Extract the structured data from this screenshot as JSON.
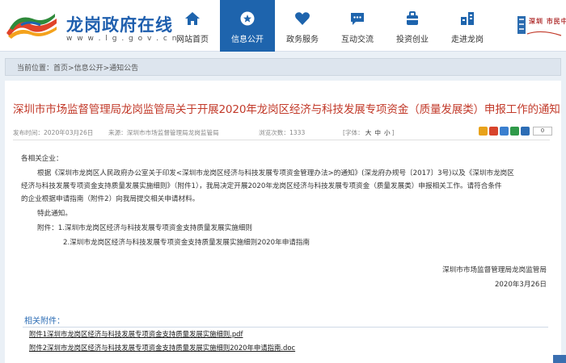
{
  "site": {
    "title": "龙岗政府在线",
    "url": "w w w . l g . g o v . c n",
    "brand_badge": "深圳 市民中心"
  },
  "nav": {
    "items": [
      {
        "label": "网站首页",
        "icon": "home-icon",
        "active": false
      },
      {
        "label": "信息公开",
        "icon": "info-icon",
        "active": true
      },
      {
        "label": "政务服务",
        "icon": "heart-icon",
        "active": false
      },
      {
        "label": "互动交流",
        "icon": "chat-icon",
        "active": false
      },
      {
        "label": "投资创业",
        "icon": "invest-icon",
        "active": false
      },
      {
        "label": "走进龙岗",
        "icon": "building-icon",
        "active": false
      }
    ]
  },
  "breadcrumb": {
    "prefix": "当前位置：",
    "items": [
      "首页",
      "信息公开",
      "通知公告"
    ],
    "separator": ">"
  },
  "article": {
    "title": "深圳市市场监督管理局龙岗监管局关于开展2020年龙岗区经济与科技发展专项资金（质量发展类）申报工作的通知",
    "meta": {
      "date_label": "发布时间：",
      "date": "2020年03月26日",
      "source_label": "来源：",
      "source": "深圳市市场监督管理局龙岗监管局",
      "views_label": "浏览次数：",
      "views": "1333",
      "fontsize_label": "[字体：",
      "fontsize_options": [
        "大",
        "中",
        "小"
      ],
      "fontsize_close": "]"
    },
    "share_count": "0",
    "greeting": "各相关企业：",
    "para1_line1": "根据《深圳市龙岗区人民政府办公室关于印发<深圳市龙岗区经济与科技发展专项资金管理办法>的通知》(深龙府办规号〔2017〕3号)以及《深圳市龙岗区",
    "para1_line2": "经济与科技发展专项资金支持质量发展实施细则》（附件1），我局决定开展2020年龙岗区经济与科技发展专项资金（质量发展类）申报相关工作。请符合条件",
    "para1_line3": "的企业根据申请指南（附件2）向我局提交相关申请材料。",
    "notice": "特此通知。",
    "attachments_inline": [
      "附件：1.深圳市龙岗区经济与科技发展专项资金支持质量发展实施细则",
      "2.深圳市龙岗区经济与科技发展专项资金支持质量发展实施细则2020年申请指南"
    ],
    "signature_org": "深圳市市场监督管理局龙岗监管局",
    "signature_date": "2020年3月26日",
    "attachments_title": "相关附件：",
    "attachments": [
      "附件1深圳市龙岗区经济与科技发展专项资金支持质量发展实施细则.pdf",
      "附件2深圳市龙岗区经济与科技发展专项资金支持质量发展实施细则2020年申请指南.doc"
    ]
  },
  "colors": {
    "brand_blue": "#1e64ad",
    "title_red": "#c23a2a",
    "link_blue": "#2d6db5"
  }
}
